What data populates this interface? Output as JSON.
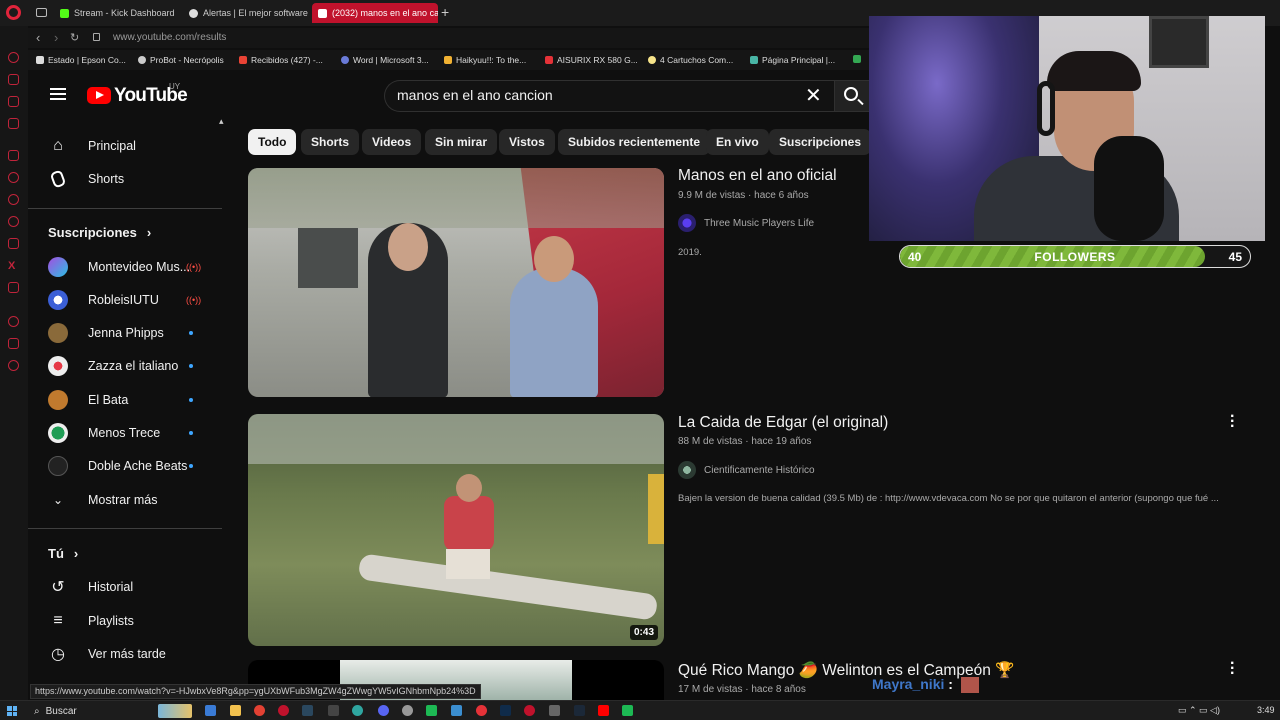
{
  "browser": {
    "tabs": [
      {
        "label": "Stream - Kick Dashboard",
        "color": "#53fc18"
      },
      {
        "label": "Alertas | El mejor software",
        "color": "#dddddd"
      },
      {
        "label": "(2032) manos en el ano ca",
        "color": "#ff0000"
      }
    ],
    "url": "www.youtube.com/results",
    "bookmarks": [
      "Estado | Epson Co...",
      "ProBot - Necrópolis",
      "Recibidos (427) -...",
      "Word | Microsoft 3...",
      "Haikyuu!!: To the...",
      "AISURIX RX 580 G...",
      "4 Cartuchos Com...",
      "Página Principal |..."
    ],
    "status_url": "https://www.youtube.com/watch?v=-HJwbxVe8Rg&pp=ygUXbWFub3MgZW4gZWwgYW5vIGNhbmNpb24%3D"
  },
  "youtube": {
    "logo_text": "YouTube",
    "country": "UY",
    "search_query": "manos en el ano cancion",
    "sidebar": {
      "main": [
        {
          "label": "Principal",
          "icon": "home-icon"
        },
        {
          "label": "Shorts",
          "icon": "shorts-icon"
        }
      ],
      "subscriptions_title": "Suscripciones",
      "subscriptions": [
        {
          "label": "Montevideo Mus...",
          "status": "live",
          "color": "#7b3fe4"
        },
        {
          "label": "RobleisIUTU",
          "status": "live",
          "color": "#3b5fd6"
        },
        {
          "label": "Jenna Phipps",
          "status": "new",
          "color": "#8a6a3a"
        },
        {
          "label": "Zazza el italiano",
          "status": "new",
          "color": "#e8e8e8"
        },
        {
          "label": "El Bata",
          "status": "new",
          "color": "#c07a2e"
        },
        {
          "label": "Menos Trece",
          "status": "new",
          "color": "#1f9d55"
        },
        {
          "label": "Doble Ache Beats",
          "status": "new",
          "color": "#222222"
        }
      ],
      "show_more": "Mostrar más",
      "you_title": "Tú",
      "you_items": [
        {
          "label": "Historial",
          "icon": "history-icon"
        },
        {
          "label": "Playlists",
          "icon": "playlists-icon"
        },
        {
          "label": "Ver más tarde",
          "icon": "watch-later-icon"
        }
      ]
    },
    "chips": [
      "Todo",
      "Shorts",
      "Videos",
      "Sin mirar",
      "Vistos",
      "Subidos recientemente",
      "En vivo",
      "Suscripciones"
    ],
    "results": [
      {
        "title": "Manos en el ano oficial",
        "meta": "9.9 M de vistas · hace 6 años",
        "channel": "Three Music Players Life",
        "description": "2019.",
        "duration": ""
      },
      {
        "title": "La Caida de Edgar (el original)",
        "meta": "88 M de vistas · hace 19 años",
        "channel": "Cientificamente Histórico",
        "description": "Bajen la version de buena calidad (39.5 Mb) de : http://www.vdevaca.com No se por que quitaron el anterior (supongo que fué ...",
        "duration": "0:43"
      },
      {
        "title": "Qué Rico Mango 🥭 Welinton es el Campeón 🏆",
        "meta": "17 M de vistas · hace 8 años",
        "channel": "",
        "description": "",
        "duration": ""
      }
    ]
  },
  "overlay": {
    "followers_current": "40",
    "followers_label": "FOLLOWERS",
    "followers_goal": "45",
    "followers_progress": 0.87,
    "chat_user": "Mayra_niki",
    "chat_sep": ":"
  },
  "taskbar": {
    "search_label": "Buscar",
    "time": "3:49"
  }
}
